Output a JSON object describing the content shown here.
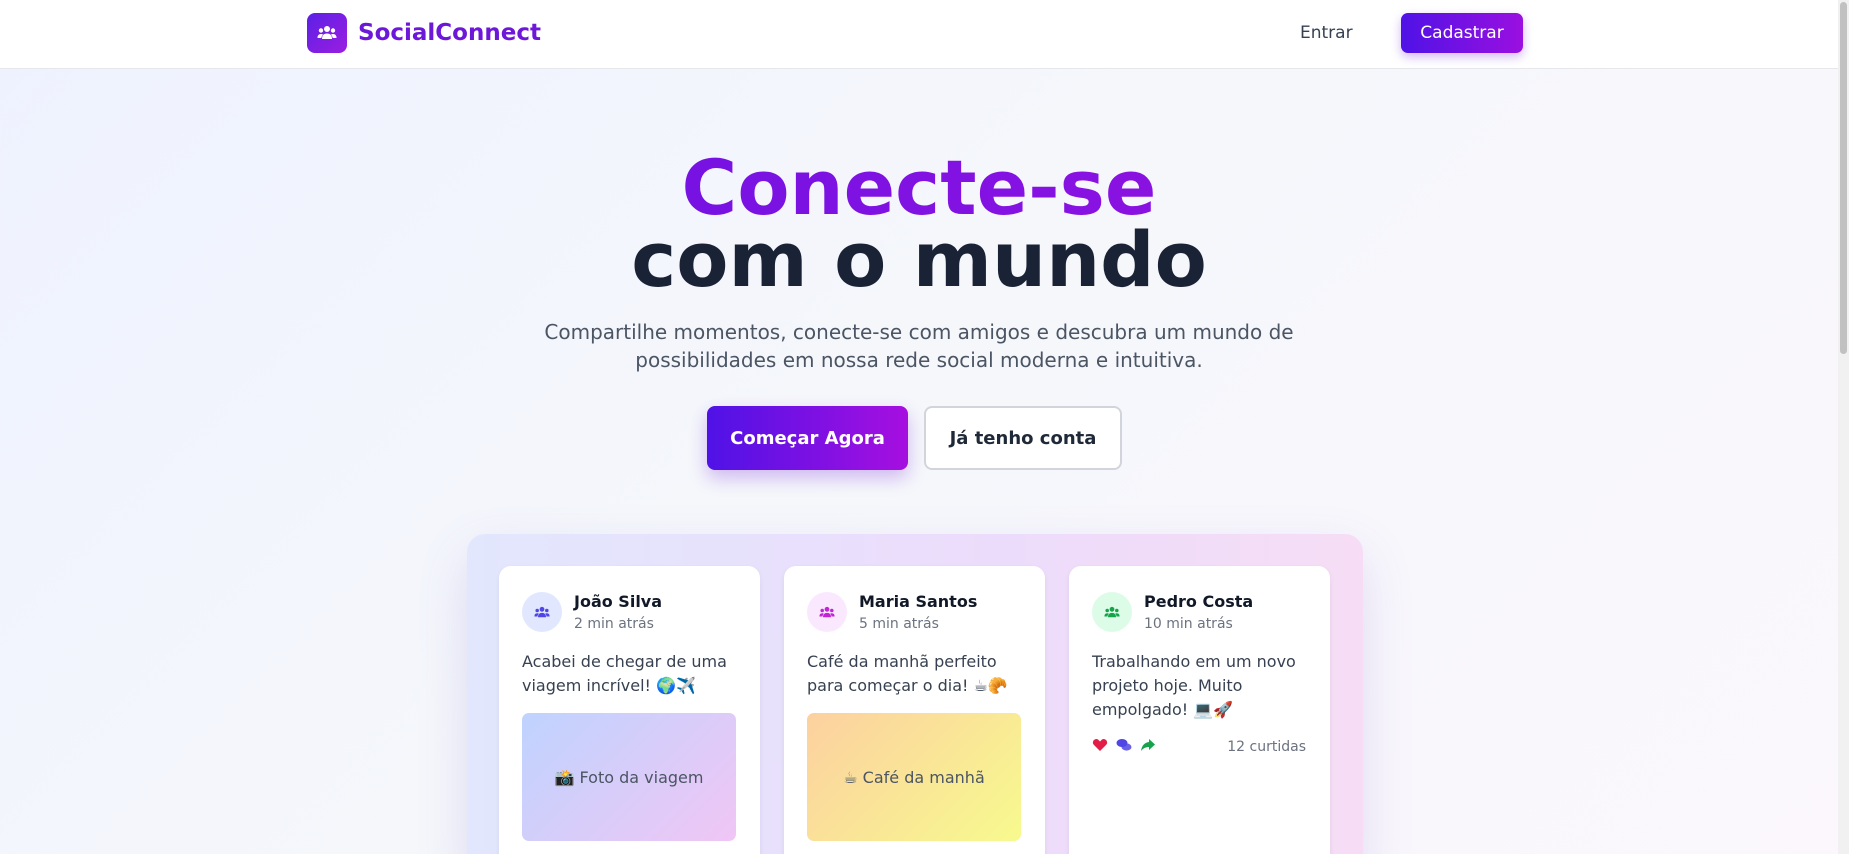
{
  "header": {
    "brand": "SocialConnect",
    "login": "Entrar",
    "signup": "Cadastrar"
  },
  "hero": {
    "title_line1": "Conecte-se",
    "title_line2": "com o mundo",
    "subtitle_line1": "Compartilhe momentos, conecte-se com amigos e descubra um mundo de",
    "subtitle_line2": "possibilidades em nossa rede social moderna e intuitiva.",
    "cta_primary": "Começar Agora",
    "cta_secondary": "Já tenho conta"
  },
  "posts": [
    {
      "author": "João Silva",
      "time": "2 min atrás",
      "text": "Acabei de chegar de uma viagem incrível! 🌍✈️",
      "media": "📸 Foto da viagem",
      "avatar_color": "#e0e7ff",
      "avatar_icon_color": "#4f46e5"
    },
    {
      "author": "Maria Santos",
      "time": "5 min atrás",
      "text": "Café da manhã perfeito para começar o dia! ☕🥐",
      "media": "☕ Café da manhã",
      "avatar_color": "#fae8ff",
      "avatar_icon_color": "#c026d3"
    },
    {
      "author": "Pedro Costa",
      "time": "10 min atrás",
      "text": "Trabalhando em um novo projeto hoje. Muito empolgado! 💻🚀",
      "likes": "12 curtidas",
      "avatar_color": "#dcfce7",
      "avatar_icon_color": "#16a34a"
    }
  ],
  "colors": {
    "brand": "#6d17d8",
    "accent_start": "#4f12e6",
    "accent_end": "#a60fe0"
  },
  "icons": {
    "logo": "users-icon",
    "like": "heart-icon",
    "comment": "comments-icon",
    "share": "share-icon"
  }
}
